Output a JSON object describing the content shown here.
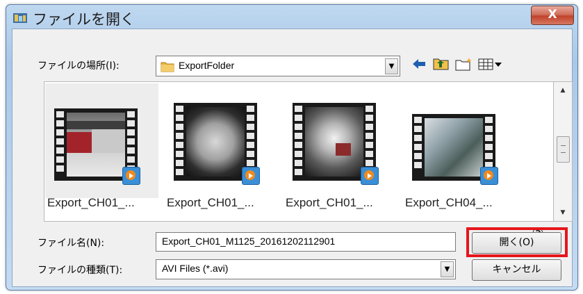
{
  "window": {
    "title": "ファイルを開く",
    "close_label": "X"
  },
  "location": {
    "label": "ファイルの場所(I):",
    "value": "ExportFolder"
  },
  "files": [
    {
      "name": "Export_CH01_...",
      "selected": true
    },
    {
      "name": "Export_CH01_...",
      "selected": false
    },
    {
      "name": "Export_CH01_...",
      "selected": false
    },
    {
      "name": "Export_CH04_...",
      "selected": false
    }
  ],
  "callout_marker": "③",
  "filename": {
    "label": "ファイル名(N):",
    "value": "Export_CH01_M1125_20161202112901"
  },
  "filetype": {
    "label": "ファイルの種類(T):",
    "value": "AVI Files (*.avi)"
  },
  "buttons": {
    "open": "開く(O)",
    "cancel": "キャンセル"
  },
  "colors": {
    "highlight": "#e5161c",
    "folder": "#e8b43a",
    "play_badge": "#3a8fd6"
  },
  "icons": [
    "folder-icon",
    "back-arrow-icon",
    "up-folder-icon",
    "new-folder-icon",
    "view-menu-icon",
    "play-badge-icon"
  ]
}
